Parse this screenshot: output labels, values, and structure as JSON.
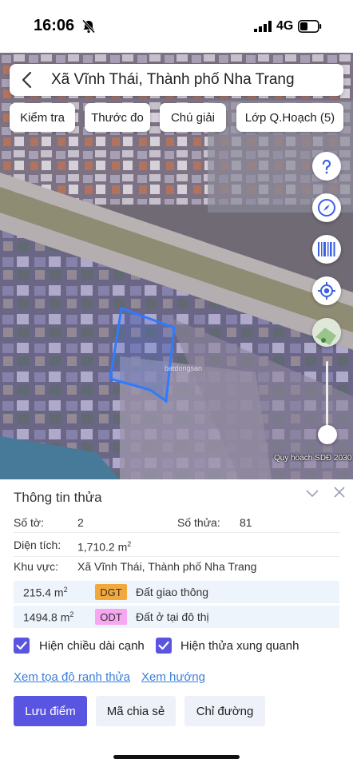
{
  "status_bar": {
    "time": "16:06",
    "network": "4G"
  },
  "search": {
    "title": "Xã Vĩnh Thái, Thành phố Nha Trang"
  },
  "toolbar": {
    "chips": [
      "Kiểm tra",
      "Thước đo",
      "Chú giải",
      "Lớp Q.Hoạch (5)"
    ]
  },
  "map": {
    "side_buttons": [
      "help-icon",
      "compass-icon",
      "barcode-icon",
      "locate-icon",
      "layer-thumbnail-icon"
    ],
    "caption": "Quy hoạch SDĐ 2030",
    "watermark": "batdongsan"
  },
  "panel": {
    "title": "Thông tin thửa",
    "so_to_label": "Số tờ:",
    "so_to_value": "2",
    "so_thua_label": "Số thửa:",
    "so_thua_value": "81",
    "dien_tich_label": "Diện tích:",
    "dien_tich_value": "1,710.2 m",
    "dien_tich_unit_sup": "2",
    "khu_vuc_label": "Khu vực:",
    "khu_vuc_value": "Xã Vĩnh Thái, Thành phố Nha Trang",
    "land_uses": [
      {
        "area": "215.4 m",
        "sup": "2",
        "code": "DGT",
        "color": "#f2a93b",
        "desc": "Đất giao thông"
      },
      {
        "area": "1494.8 m",
        "sup": "2",
        "code": "ODT",
        "color": "#f7a6f2",
        "desc": "Đất ở tại đô thị"
      }
    ],
    "checkbox_edges": "Hiện chiều dài cạnh",
    "checkbox_neighbors": "Hiện thửa xung quanh",
    "link_coords": "Xem tọa độ ranh thửa",
    "link_direction": "Xem hướng",
    "btn_save": "Lưu điểm",
    "btn_share": "Mã chia sẻ",
    "btn_route": "Chỉ đường"
  },
  "colors": {
    "accent": "#5a55e0",
    "link": "#3b7fd9",
    "parcel_outline": "#2f7bff"
  }
}
